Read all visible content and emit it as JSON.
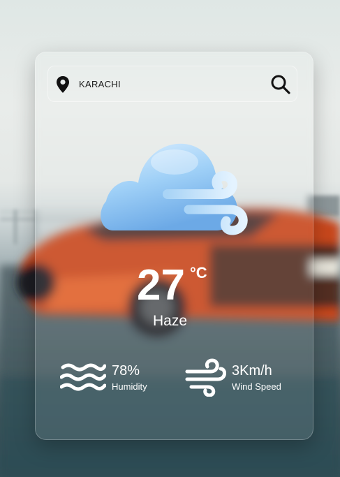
{
  "search": {
    "city": "KARACHI"
  },
  "weather": {
    "temperature": "27",
    "unit": "°C",
    "condition": "Haze"
  },
  "stats": {
    "humidity": {
      "value": "78%",
      "label": "Humidity",
      "icon": "waves-icon"
    },
    "wind": {
      "value": "3Km/h",
      "label": "Wind Speed",
      "icon": "wind-icon"
    }
  },
  "icons": {
    "location": "map-pin-icon",
    "search": "search-icon",
    "weather": "cloud-wind-icon"
  },
  "colors": {
    "accent_car": "#d9531f",
    "cloud": "#8ec4f2",
    "text": "#ffffff"
  }
}
